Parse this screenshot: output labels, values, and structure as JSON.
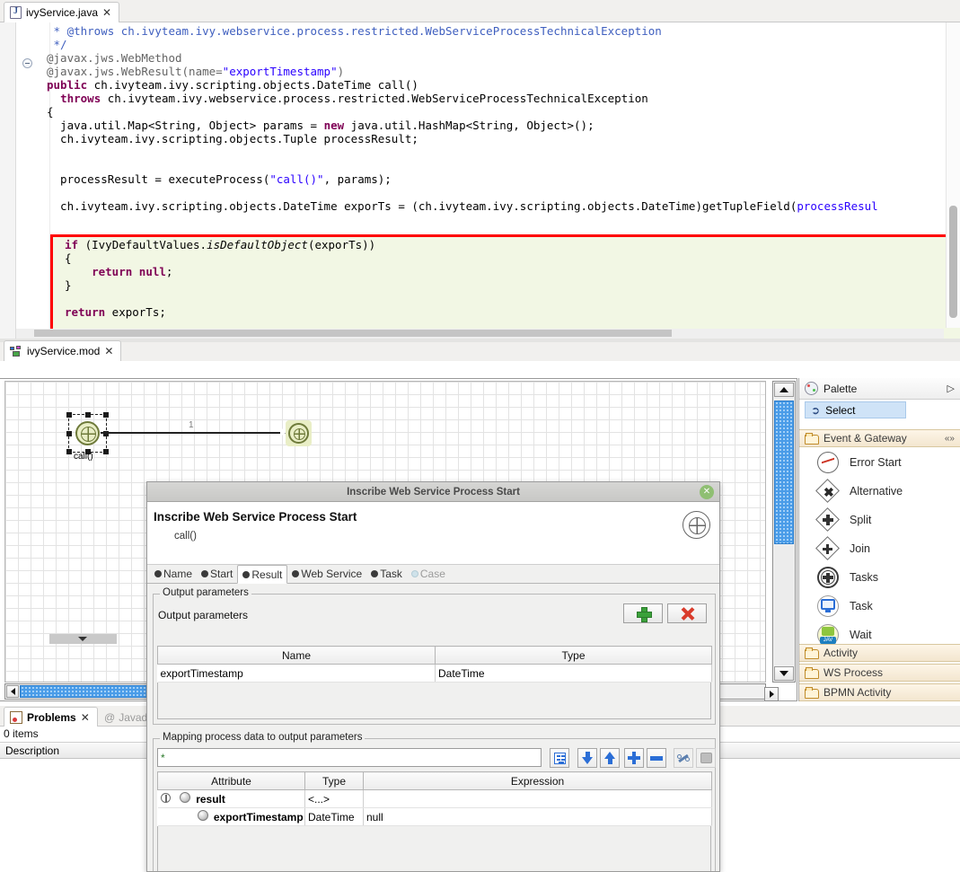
{
  "editor": {
    "tab": {
      "label": "ivyService.java",
      "icon": "java-file-icon",
      "close": "✕"
    },
    "code_lines": [
      " * @throws ch.ivyteam.ivy.webservice.process.restricted.WebServiceProcessTechnicalException",
      " */",
      "@javax.jws.WebMethod",
      "@javax.jws.WebResult(name=\"exportTimestamp\")",
      "public ch.ivyteam.ivy.scripting.objects.DateTime call()",
      "  throws ch.ivyteam.ivy.webservice.process.restricted.WebServiceProcessTechnicalException",
      "{",
      "  java.util.Map<String, Object> params = new java.util.HashMap<String, Object>();",
      "  ch.ivyteam.ivy.scripting.objects.Tuple processResult;",
      "",
      "  processResult = executeProcess(\"call()\", params);",
      "",
      "  ch.ivyteam.ivy.scripting.objects.DateTime exporTs = (ch.ivyteam.ivy.scripting.objects.DateTime)getTupleField(processResul"
    ],
    "highlighted_block": [
      "if (IvyDefaultValues.isDefaultObject(exporTs))",
      "{",
      "    return null;",
      "}",
      "",
      "return exporTs;"
    ],
    "closing_brace": "}"
  },
  "mod_editor": {
    "tab": {
      "label": "ivyService.mod",
      "icon": "process-model-icon",
      "close": "✕"
    },
    "diagram": {
      "start_node_label": "call()",
      "flow_label": "1",
      "start_node_name": "web-service-process-start-node",
      "end_node_name": "web-service-process-end-node"
    }
  },
  "palette": {
    "title": "Palette",
    "select_label": "Select",
    "groups": [
      {
        "label": "Event & Gateway",
        "expanded": true
      },
      {
        "label": "Activity",
        "expanded": false
      },
      {
        "label": "WS Process",
        "expanded": false
      },
      {
        "label": "BPMN Activity",
        "expanded": false
      }
    ],
    "items": [
      {
        "label": "Error Start",
        "icon": "error-start-icon"
      },
      {
        "label": "Alternative",
        "icon": "alternative-gateway-icon"
      },
      {
        "label": "Split",
        "icon": "split-gateway-icon"
      },
      {
        "label": "Join",
        "icon": "join-gateway-icon"
      },
      {
        "label": "Tasks",
        "icon": "tasks-icon"
      },
      {
        "label": "Task",
        "icon": "task-icon"
      },
      {
        "label": "Wait",
        "icon": "wait-icon"
      }
    ]
  },
  "problems": {
    "tab_label": "Problems",
    "tab_close": "✕",
    "tab2_label": "Javado",
    "tab2_icon": "at-sign-icon",
    "count": "0 items",
    "column": "Description"
  },
  "dialog": {
    "window_title": "Inscribe Web Service Process Start",
    "close_label": "✕",
    "heading": "Inscribe Web Service Process Start",
    "subheading": "call()",
    "tabs": [
      {
        "label": "Name",
        "active": false,
        "enabled": true
      },
      {
        "label": "Start",
        "active": false,
        "enabled": true
      },
      {
        "label": "Result",
        "active": true,
        "enabled": true
      },
      {
        "label": "Web Service",
        "active": false,
        "enabled": true
      },
      {
        "label": "Task",
        "active": false,
        "enabled": true
      },
      {
        "label": "Case",
        "active": false,
        "enabled": false
      }
    ],
    "output_parameters": {
      "group_legend": "Output parameters",
      "inner_label": "Output parameters",
      "add_button": "add-parameter-button",
      "remove_button": "remove-parameter-button",
      "columns": [
        "Name",
        "Type"
      ],
      "rows": [
        {
          "name": "exportTimestamp",
          "type": "DateTime"
        }
      ]
    },
    "mapping": {
      "group_legend": "Mapping process data to output parameters",
      "filter_value": "*",
      "toolbar": [
        {
          "icon": "tree-outline-icon",
          "enabled": true
        },
        {
          "icon": "arrow-down-icon",
          "enabled": true
        },
        {
          "icon": "arrow-up-icon",
          "enabled": true
        },
        {
          "icon": "plus-icon",
          "enabled": true
        },
        {
          "icon": "minus-icon",
          "enabled": true
        },
        {
          "icon": "wrench-icon",
          "enabled": true
        },
        {
          "icon": "stamp-icon",
          "enabled": false
        }
      ],
      "columns": [
        "Attribute",
        "Type",
        "Expression"
      ],
      "rows": [
        {
          "attribute": "result",
          "type": "<...>",
          "expression": "",
          "indent": 0,
          "expandable": true
        },
        {
          "attribute": "exportTimestamp",
          "type": "DateTime",
          "expression": "null",
          "indent": 1,
          "expandable": false
        }
      ]
    }
  },
  "colors": {
    "highlight_border": "#ff0000",
    "highlight_bg": "#f2f7e4",
    "node_fill": "#e9eec6",
    "node_stroke": "#6e7a3a",
    "scrollbar_thumb": "#4a9ce8",
    "tab_active_bg": "#ffffff",
    "palette_group_bg": "#f3e6cf"
  }
}
